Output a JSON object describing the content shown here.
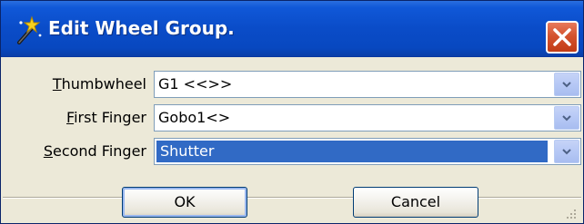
{
  "window": {
    "title": "Edit Wheel Group.",
    "title_icon": "wand-icon",
    "close_icon": "close-icon"
  },
  "fields": [
    {
      "label_mnemonic": "T",
      "label_rest": "humbwheel",
      "value": "G1 <<>>",
      "selected": false
    },
    {
      "label_mnemonic": "F",
      "label_rest": "irst Finger",
      "value": "Gobo1<>",
      "selected": false
    },
    {
      "label_mnemonic": "S",
      "label_rest": "econd Finger",
      "value": "Shutter",
      "selected": true
    }
  ],
  "buttons": {
    "ok_label": "OK",
    "cancel_label": "Cancel"
  },
  "colors": {
    "titlebar": "#0a4cc8",
    "selection": "#316ac5",
    "close_button": "#d4532f",
    "face": "#ece9d8"
  }
}
